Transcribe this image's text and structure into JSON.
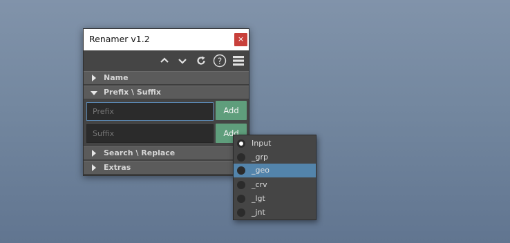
{
  "window": {
    "title": "Renamer v1.2",
    "close_glyph": "×"
  },
  "toolbar": {
    "icons": [
      "chevron-up-icon",
      "chevron-down-icon",
      "refresh-icon",
      "help-icon",
      "menu-icon"
    ],
    "help_glyph": "?"
  },
  "sections": {
    "name": {
      "label": "Name",
      "expanded": false
    },
    "prefix_suffix": {
      "label": "Prefix \\ Suffix",
      "expanded": true
    },
    "search_replace": {
      "label": "Search \\ Replace",
      "expanded": false
    },
    "extras": {
      "label": "Extras",
      "expanded": false
    }
  },
  "prefix_suffix": {
    "prefix_placeholder": "Prefix",
    "prefix_value": "",
    "suffix_placeholder": "Suffix",
    "suffix_value": "",
    "prefix_add_label": "Add",
    "suffix_add_label": "Add"
  },
  "popup": {
    "options": [
      {
        "label": "Input",
        "checked": true,
        "highlighted": false
      },
      {
        "label": "_grp",
        "checked": false,
        "highlighted": false
      },
      {
        "label": "_geo",
        "checked": false,
        "highlighted": true
      },
      {
        "label": "_crv",
        "checked": false,
        "highlighted": false
      },
      {
        "label": "_lgt",
        "checked": false,
        "highlighted": false
      },
      {
        "label": "_jnt",
        "checked": false,
        "highlighted": false
      }
    ]
  },
  "colors": {
    "accent_button": "#5f9e7c",
    "selection": "#5384ab",
    "close_button": "#c8403b"
  }
}
